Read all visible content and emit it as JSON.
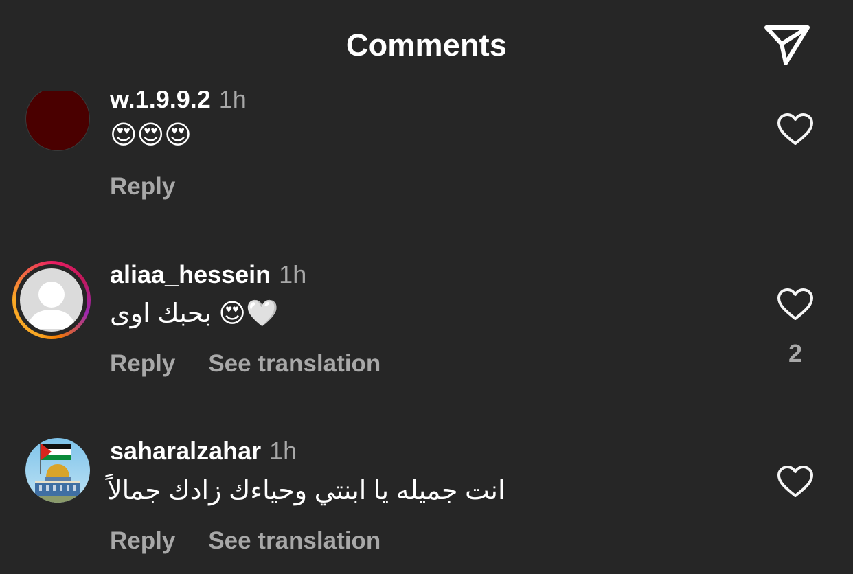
{
  "header": {
    "title": "Comments",
    "send_icon": "paper-plane-icon"
  },
  "comments": [
    {
      "username": "w.1.9.9.2",
      "time": "1h",
      "text": "😍😍😍",
      "reply_label": "Reply",
      "avatar_color": "#4a0000"
    },
    {
      "username": "aliaa_hessein",
      "time": "1h",
      "text": "بحبك اوى 😍🤍",
      "reply_label": "Reply",
      "translate_label": "See translation",
      "like_count": "2"
    },
    {
      "username": "saharalzahar",
      "time": "1h",
      "text": "انت جميله يا ابنتي وحياءك زادك جمالاً",
      "reply_label": "Reply",
      "translate_label": "See translation"
    }
  ],
  "colors": {
    "background": "#262626",
    "primary_text": "#ffffff",
    "secondary_text": "#a8a8a8"
  }
}
